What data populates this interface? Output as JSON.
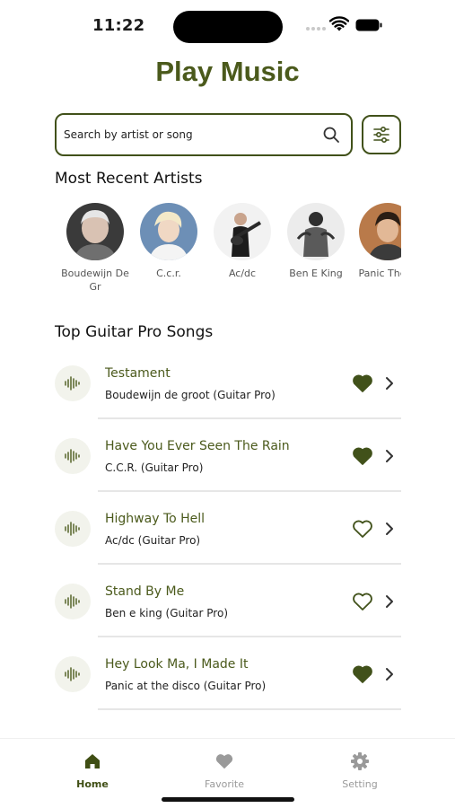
{
  "status_bar": {
    "time": "11:22"
  },
  "header": {
    "title": "Play Music"
  },
  "search": {
    "placeholder": "Search by artist or song",
    "value": ""
  },
  "recent_artists": {
    "title": "Most Recent Artists",
    "items": [
      {
        "name": "Boudewijn De Gr"
      },
      {
        "name": "C.c.r."
      },
      {
        "name": "Ac/dc"
      },
      {
        "name": "Ben E King"
      },
      {
        "name": "Panic The D"
      }
    ]
  },
  "top_songs": {
    "title": "Top Guitar Pro Songs",
    "items": [
      {
        "title": "Testament",
        "artist": "Boudewijn de groot (Guitar Pro)",
        "favorite": true
      },
      {
        "title": "Have You Ever Seen The Rain",
        "artist": "C.C.R. (Guitar Pro)",
        "favorite": true
      },
      {
        "title": "Highway To Hell",
        "artist": "Ac/dc (Guitar Pro)",
        "favorite": false
      },
      {
        "title": "Stand By Me",
        "artist": "Ben e king (Guitar Pro)",
        "favorite": false
      },
      {
        "title": "Hey Look Ma, I Made It",
        "artist": "Panic at the disco (Guitar Pro)",
        "favorite": true
      }
    ]
  },
  "tabs": [
    {
      "label": "Home",
      "icon": "home-icon",
      "active": true
    },
    {
      "label": "Favorite",
      "icon": "heart-icon",
      "active": false
    },
    {
      "label": "Setting",
      "icon": "gear-icon",
      "active": false
    }
  ],
  "colors": {
    "accent": "#4b5a1c",
    "dark_accent": "#3f4e14",
    "icon_bg": "#f2f3ec",
    "inactive": "#9a9a9a"
  }
}
